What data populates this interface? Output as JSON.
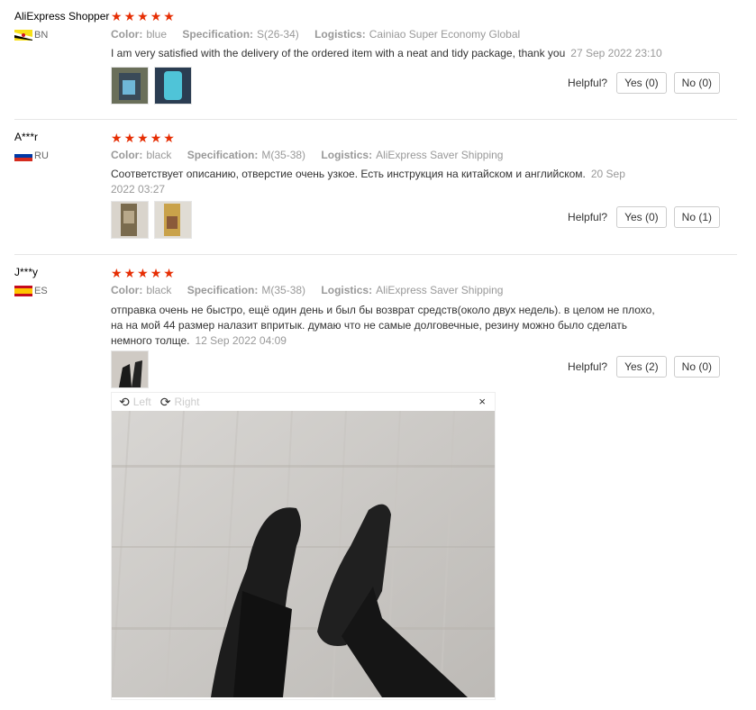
{
  "labels": {
    "color": "Color:",
    "specification": "Specification:",
    "logistics": "Logistics:",
    "helpful": "Helpful?"
  },
  "reviews": [
    {
      "user": "AliExpress Shopper",
      "country": "BN",
      "stars": 5,
      "color": "blue",
      "specification": "S(26-34)",
      "logistics": "Cainiao Super Economy Global",
      "text": "I am very satisfied with the delivery of the ordered item with a neat and tidy package, thank you",
      "date": "27 Sep 2022 23:10",
      "yes": "Yes (0)",
      "no": "No (0)"
    },
    {
      "user": "A***r",
      "country": "RU",
      "stars": 5,
      "color": "black",
      "specification": "M(35-38)",
      "logistics": "AliExpress Saver Shipping",
      "text": "Соответствует описанию, отверстие очень узкое. Есть инструкция на китайском и английском.",
      "date": "20 Sep 2022 03:27",
      "yes": "Yes (0)",
      "no": "No (1)"
    },
    {
      "user": "J***y",
      "country": "ES",
      "stars": 5,
      "color": "black",
      "specification": "M(35-38)",
      "logistics": "AliExpress Saver Shipping",
      "text": "отправка очень не быстро, ещё один день и был бы возврат средств(около двух недель). в целом не плохо, на на мой 44 размер налазит впритык. думаю что не самые долговечные, резину можно было сделать немного толще.",
      "date": "12 Sep 2022 04:09",
      "yes": "Yes (2)",
      "no": "No (0)"
    }
  ],
  "viewer": {
    "left": "Left",
    "right": "Right",
    "close": "×"
  },
  "icons": {
    "star": "star-icon",
    "rotate_left": "rotate-left-icon",
    "rotate_right": "rotate-right-icon",
    "close": "close-icon"
  },
  "colors": {
    "star": "#e62e04",
    "muted": "#999999"
  }
}
